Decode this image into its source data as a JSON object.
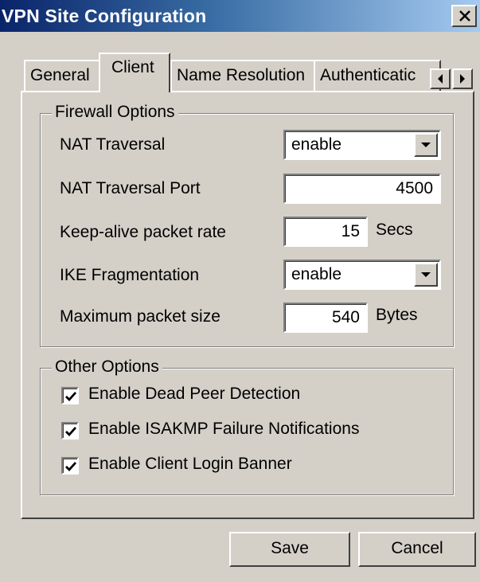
{
  "window": {
    "title": "VPN Site Configuration"
  },
  "tabs": [
    {
      "label": "General",
      "active": false
    },
    {
      "label": "Client",
      "active": true
    },
    {
      "label": "Name Resolution",
      "active": false
    },
    {
      "label": "Authenticatic",
      "active": false
    }
  ],
  "firewall": {
    "title": "Firewall Options",
    "nat_traversal": {
      "label": "NAT Traversal",
      "value": "enable"
    },
    "nat_port": {
      "label": "NAT Traversal Port",
      "value": "4500"
    },
    "keepalive": {
      "label": "Keep-alive packet rate",
      "value": "15",
      "unit": "Secs"
    },
    "ike_frag": {
      "label": "IKE Fragmentation",
      "value": "enable"
    },
    "max_packet": {
      "label": "Maximum packet size",
      "value": "540",
      "unit": "Bytes"
    }
  },
  "other": {
    "title": "Other Options",
    "options": [
      {
        "label": "Enable Dead Peer Detection",
        "checked": true
      },
      {
        "label": "Enable ISAKMP Failure Notifications",
        "checked": true
      },
      {
        "label": "Enable Client Login Banner",
        "checked": true
      }
    ]
  },
  "buttons": {
    "save": "Save",
    "cancel": "Cancel"
  },
  "colors": {
    "dialog_face": "#d4d0c8",
    "title_start": "#0a246a",
    "title_end": "#a6caf0"
  },
  "icons": [
    "close-icon",
    "scroll-left-icon",
    "scroll-right-icon",
    "dropdown-arrow-icon",
    "checkmark-icon"
  ]
}
